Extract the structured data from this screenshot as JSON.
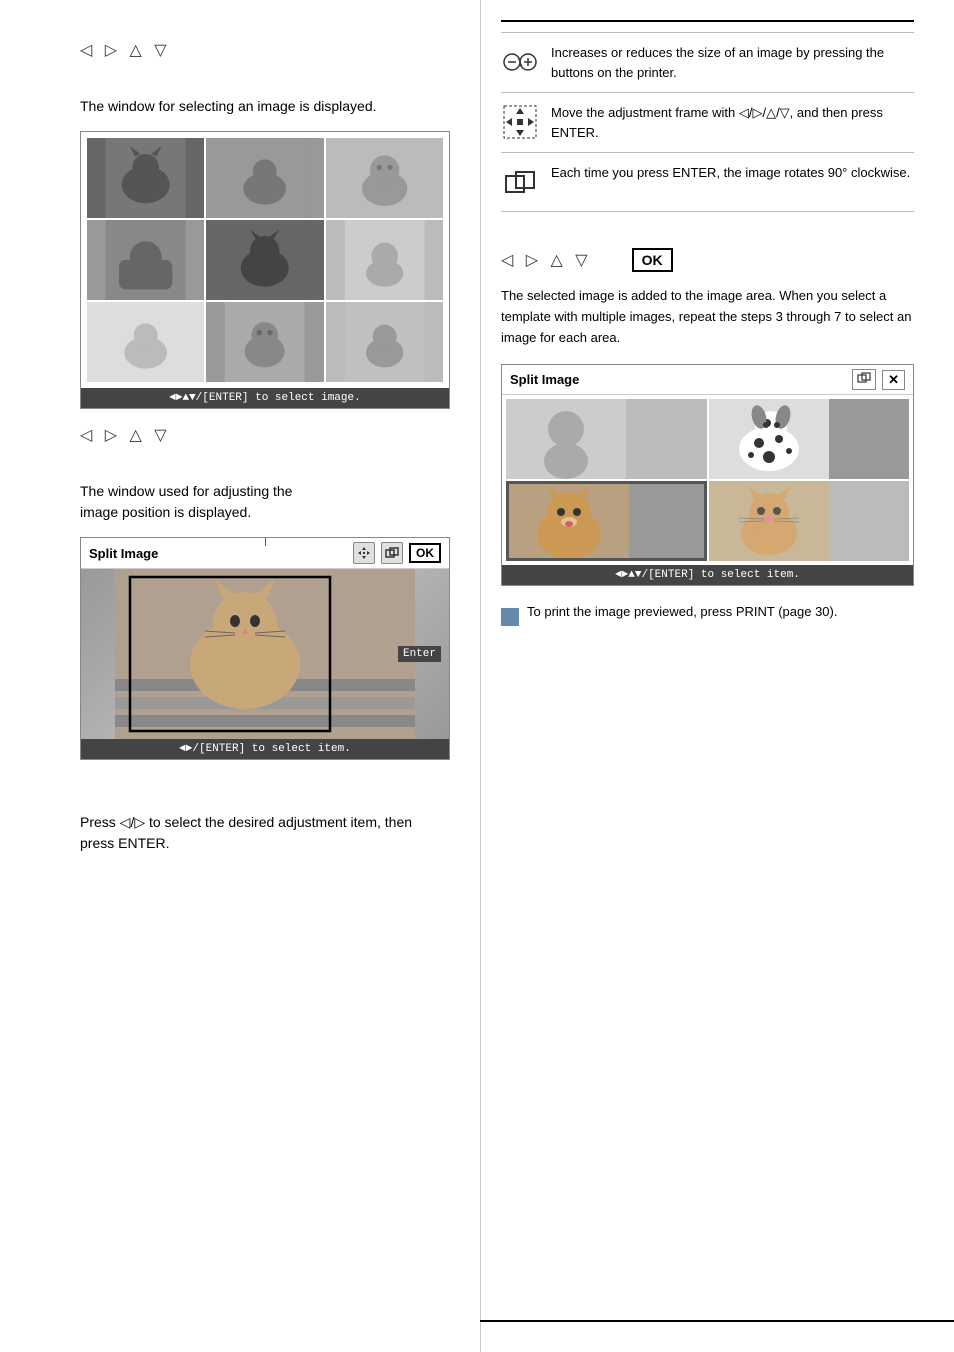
{
  "left": {
    "nav_symbols_1": "◁ ▷ △ ▽",
    "select_image_text": "The window for selecting an image is displayed.",
    "screen1_bar": "◄►▲▼/[ENTER] to select image.",
    "nav_symbols_2": "◁ ▷ △ ▽",
    "adjusting_text_1": "The window used for adjusting the",
    "adjusting_text_2": "image position is displayed.",
    "split_title_left": "Split Image",
    "ok_label_left": "OK",
    "enter_label": "Enter",
    "screen2_bar": "◄►/[ENTER] to select item.",
    "press_instruction": "Press ◁/▷ to select the desired adjustment item, then press ENTER."
  },
  "right": {
    "icon_rows": [
      {
        "icon": "⊖/⊕",
        "text": "Increases or reduces the size of an image by pressing the buttons on the printer."
      },
      {
        "icon": "✥",
        "text": "Move the adjustment frame with ◁/▷/△/▽, and then press ENTER."
      },
      {
        "icon": "↺",
        "text": "Each time you press ENTER, the image rotates 90° clockwise."
      }
    ],
    "nav_symbols": "◁ ▷ △ ▽",
    "ok_label": "OK",
    "note_text": "The selected image is added to the image area. When you select a template with multiple images, repeat the steps 3 through 7 to select an image for each area.",
    "split_title_right": "Split Image",
    "screen_bar_right": "◄►▲▼/[ENTER] to select item.",
    "print_note": "To print the image previewed, press PRINT (page 30)."
  }
}
